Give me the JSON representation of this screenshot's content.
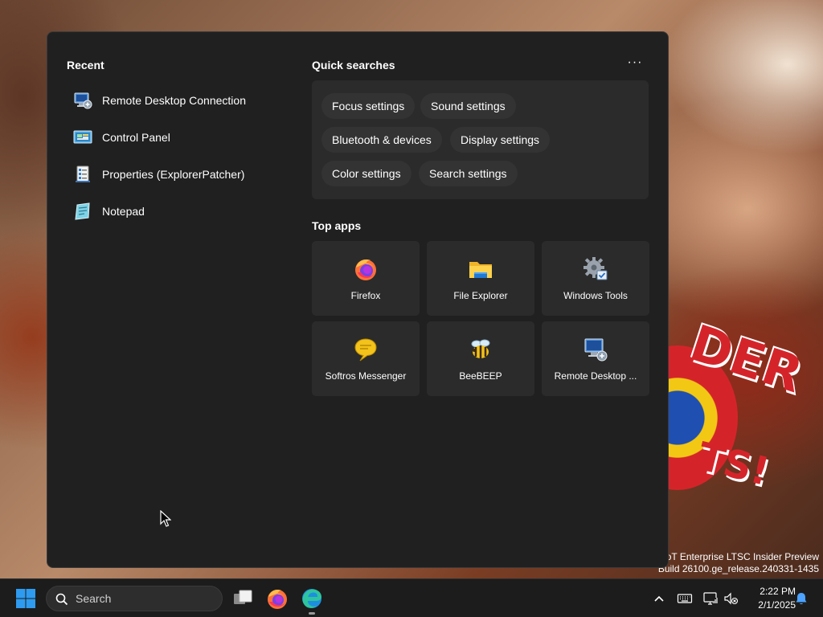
{
  "start_menu": {
    "recent": {
      "title": "Recent",
      "items": [
        {
          "label": "Remote Desktop Connection",
          "icon": "remote-desktop-icon"
        },
        {
          "label": "Control Panel",
          "icon": "control-panel-icon"
        },
        {
          "label": "Properties (ExplorerPatcher)",
          "icon": "properties-icon"
        },
        {
          "label": "Notepad",
          "icon": "notepad-icon"
        }
      ]
    },
    "quick_searches": {
      "title": "Quick searches",
      "more_label": "···",
      "chips": [
        "Focus settings",
        "Sound settings",
        "Bluetooth & devices",
        "Display settings",
        "Color settings",
        "Search settings"
      ]
    },
    "top_apps": {
      "title": "Top apps",
      "apps": [
        {
          "label": "Firefox",
          "icon": "firefox-icon"
        },
        {
          "label": "File Explorer",
          "icon": "folder-icon"
        },
        {
          "label": "Windows Tools",
          "icon": "gear-icon"
        },
        {
          "label": "Softros Messenger",
          "icon": "speech-bubble-icon"
        },
        {
          "label": "BeeBEEP",
          "icon": "bee-icon"
        },
        {
          "label": "Remote Desktop ...",
          "icon": "remote-desktop-icon"
        }
      ]
    }
  },
  "watermark": {
    "line1": "IoT Enterprise LTSC Insider Preview",
    "line2": "Build 26100.ge_release.240331-1435"
  },
  "taskbar": {
    "search_placeholder": "Search",
    "clock": {
      "time": "2:22 PM",
      "date": "2/1/2025"
    }
  },
  "colors": {
    "menu_bg": "#202020",
    "panel_bg": "#2b2b2b",
    "chip_bg": "#333333",
    "taskbar_bg": "#1c1c1c",
    "windows_blue": "#2e9bf0"
  }
}
